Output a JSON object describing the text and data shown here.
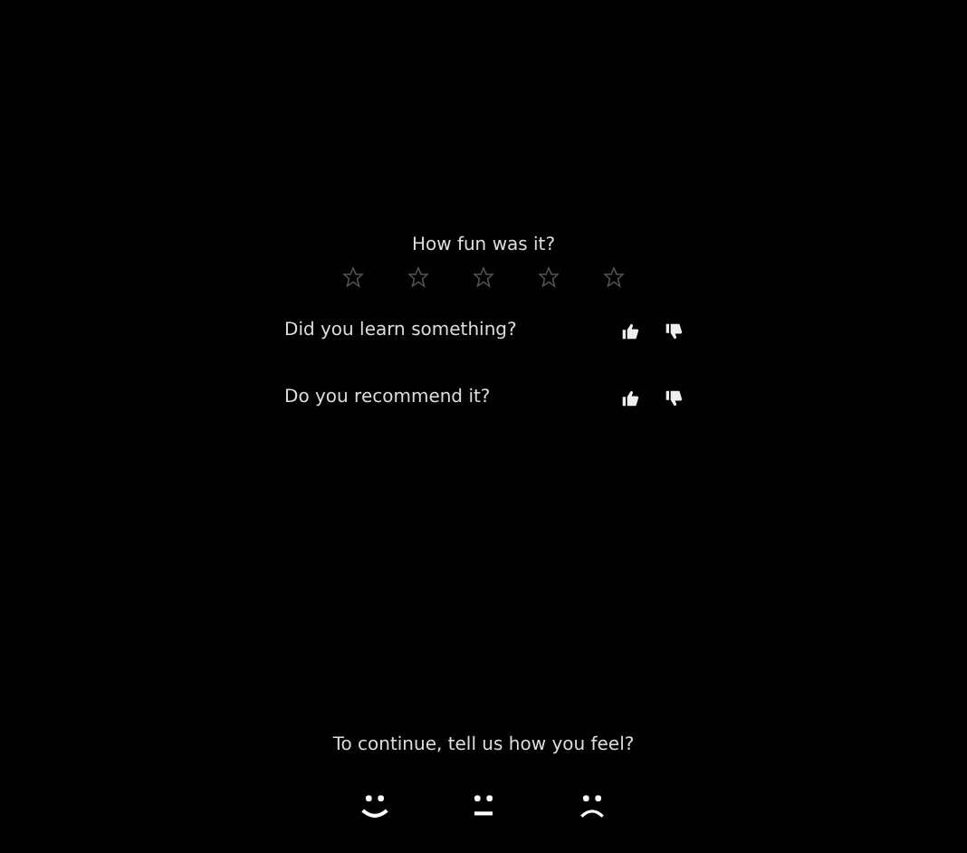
{
  "fun_question": {
    "label": "How fun was it?",
    "stars": 0
  },
  "questions": [
    {
      "label": "Did you learn something?"
    },
    {
      "label": "Do you recommend it?"
    }
  ],
  "prompt": "To continue, tell us how you feel?",
  "moods": [
    {
      "kind": "happy"
    },
    {
      "kind": "neutral"
    },
    {
      "kind": "sad"
    }
  ]
}
